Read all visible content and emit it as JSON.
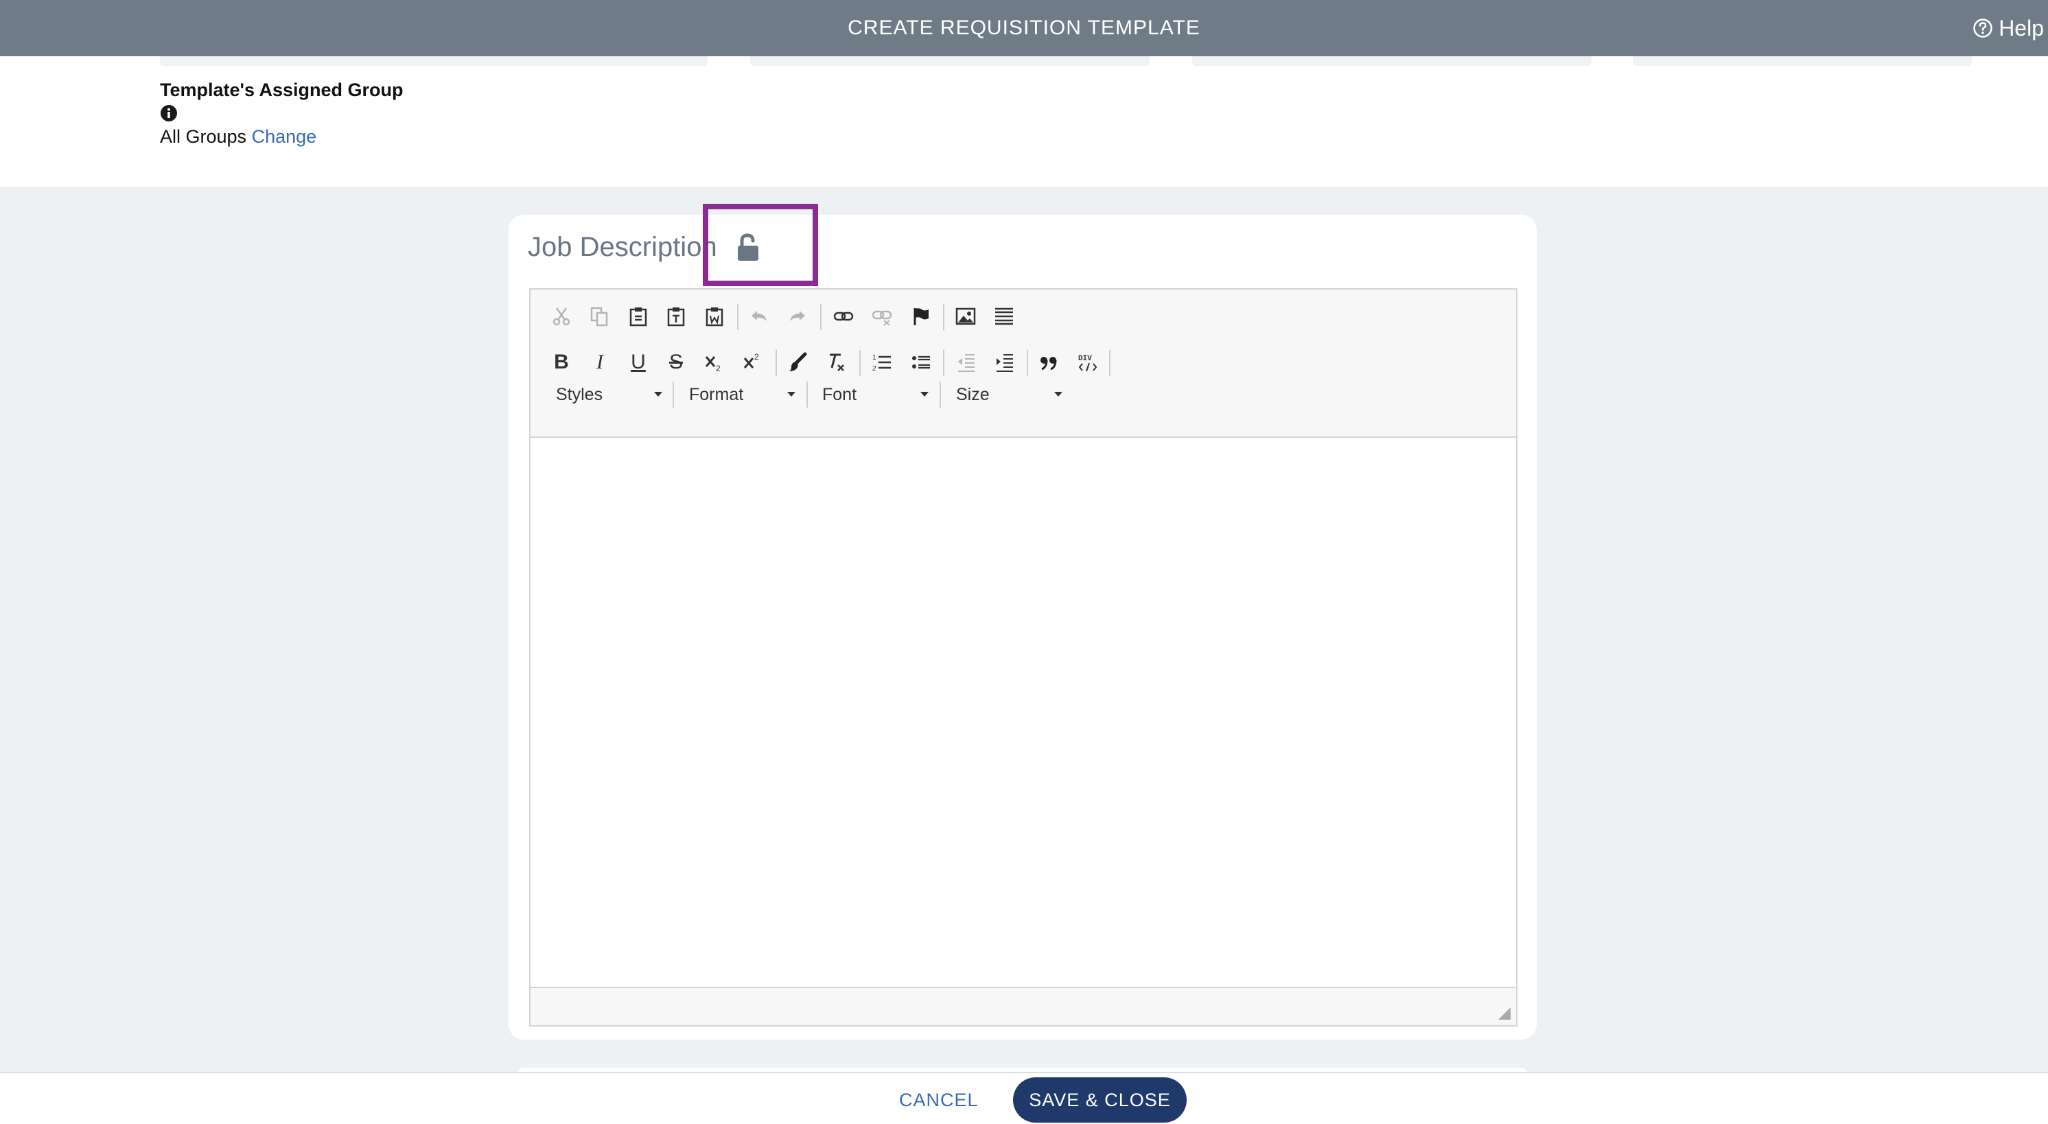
{
  "header": {
    "title": "CREATE REQUISITION TEMPLATE",
    "help_label": "Help"
  },
  "assigned_group": {
    "label": "Template's Assigned Group",
    "value": "All Groups",
    "change_label": "Change"
  },
  "job_description": {
    "title": "Job Description",
    "toolbar": {
      "row1": [
        "cut-icon",
        "copy-icon",
        "paste-icon",
        "paste-text-icon",
        "paste-word-icon",
        "undo-icon",
        "redo-icon",
        "link-icon",
        "unlink-icon",
        "anchor-icon",
        "image-icon",
        "horizontal-rule-icon"
      ],
      "row2": [
        "bold-icon",
        "italic-icon",
        "underline-icon",
        "strike-icon",
        "subscript-icon",
        "superscript-icon",
        "copy-format-icon",
        "remove-format-icon",
        "numbered-list-icon",
        "bulleted-list-icon",
        "outdent-icon",
        "indent-icon",
        "blockquote-icon",
        "div-container-icon"
      ],
      "text_buttons": {
        "bold": "B",
        "italic": "I",
        "underline": "U",
        "strike": "S"
      }
    },
    "combos": {
      "styles": "Styles",
      "format": "Format",
      "font": "Font",
      "size": "Size"
    }
  },
  "footer": {
    "cancel_label": "CANCEL",
    "save_label": "SAVE & CLOSE"
  },
  "colors": {
    "topbar": "#6f7c87",
    "link": "#3b6ab4",
    "primary_button": "#1f3a6a",
    "highlight": "#8a2c92"
  }
}
